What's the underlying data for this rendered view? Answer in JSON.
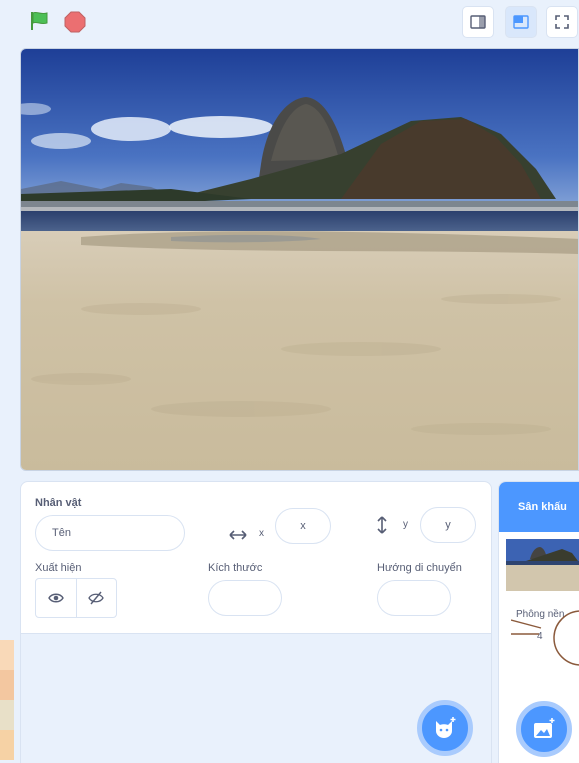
{
  "toolbar": {
    "green_flag_icon": "green-flag",
    "stop_icon": "stop-sign",
    "small_stage_icon": "small-stage-layout",
    "normal_stage_icon": "normal-stage-layout",
    "fullscreen_icon": "fullscreen"
  },
  "sprite_info": {
    "title": "Nhân vật",
    "name_placeholder": "Tên",
    "x_label": "x",
    "x_placeholder": "x",
    "y_label": "y",
    "y_placeholder": "y",
    "show_label": "Xuất hiện",
    "size_label": "Kích thước",
    "direction_label": "Hướng di chuyển"
  },
  "stage_pane": {
    "header": "Sân khấu",
    "backdrops_label": "Phông nền",
    "backdrops_count": "4"
  },
  "colors": {
    "accent": "#4c97ff",
    "flag": "#4cbf56",
    "stop": "#ec5959",
    "background": "#e9f1fc"
  }
}
